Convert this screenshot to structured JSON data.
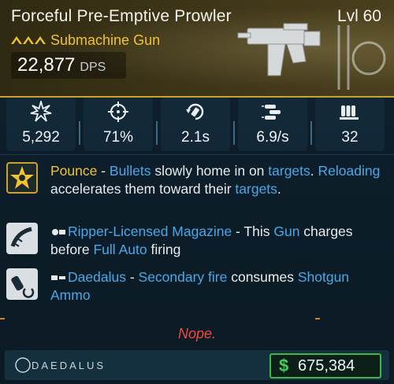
{
  "header": {
    "title": "Forceful Pre-Emptive Prowler",
    "level": "Lvl 60",
    "weapon_type": "Submachine Gun",
    "dps_value": "22,877",
    "dps_unit": "DPS",
    "rarity_color": "#f1c232",
    "rarity_icon": "rarity-chevrons-icon"
  },
  "stats": [
    {
      "icon": "damage-burst-icon",
      "value": "5,292"
    },
    {
      "icon": "accuracy-crosshair-icon",
      "value": "71%"
    },
    {
      "icon": "reload-time-icon",
      "value": "2.1s"
    },
    {
      "icon": "fire-rate-icon",
      "value": "6.9/s"
    },
    {
      "icon": "magazine-size-icon",
      "value": "32"
    }
  ],
  "perks": [
    {
      "icon": "pounce-star-icon",
      "name": "Pounce",
      "parts": [
        " - ",
        "Bullets",
        " slowly home in on ",
        "targets",
        ". ",
        "Reloading",
        " accelerates them toward their ",
        "targets",
        "."
      ]
    },
    {
      "icon": "magazine-part-icon",
      "name": "Ripper-Licensed Magazine",
      "parts": [
        " - This ",
        "Gun",
        " charges before ",
        "Full Auto",
        " firing"
      ]
    },
    {
      "icon": "daedalus-ammo-icon",
      "name": "Daedalus",
      "parts": [
        " - ",
        "Secondary fire",
        " consumes ",
        "Shotgun Ammo"
      ]
    }
  ],
  "footer": {
    "status": "Nope.",
    "brand": "DAEDALUS",
    "currency_symbol": "$",
    "price": "675,384",
    "price_color": "#3fb54a",
    "status_color": "#ef4a3a"
  }
}
